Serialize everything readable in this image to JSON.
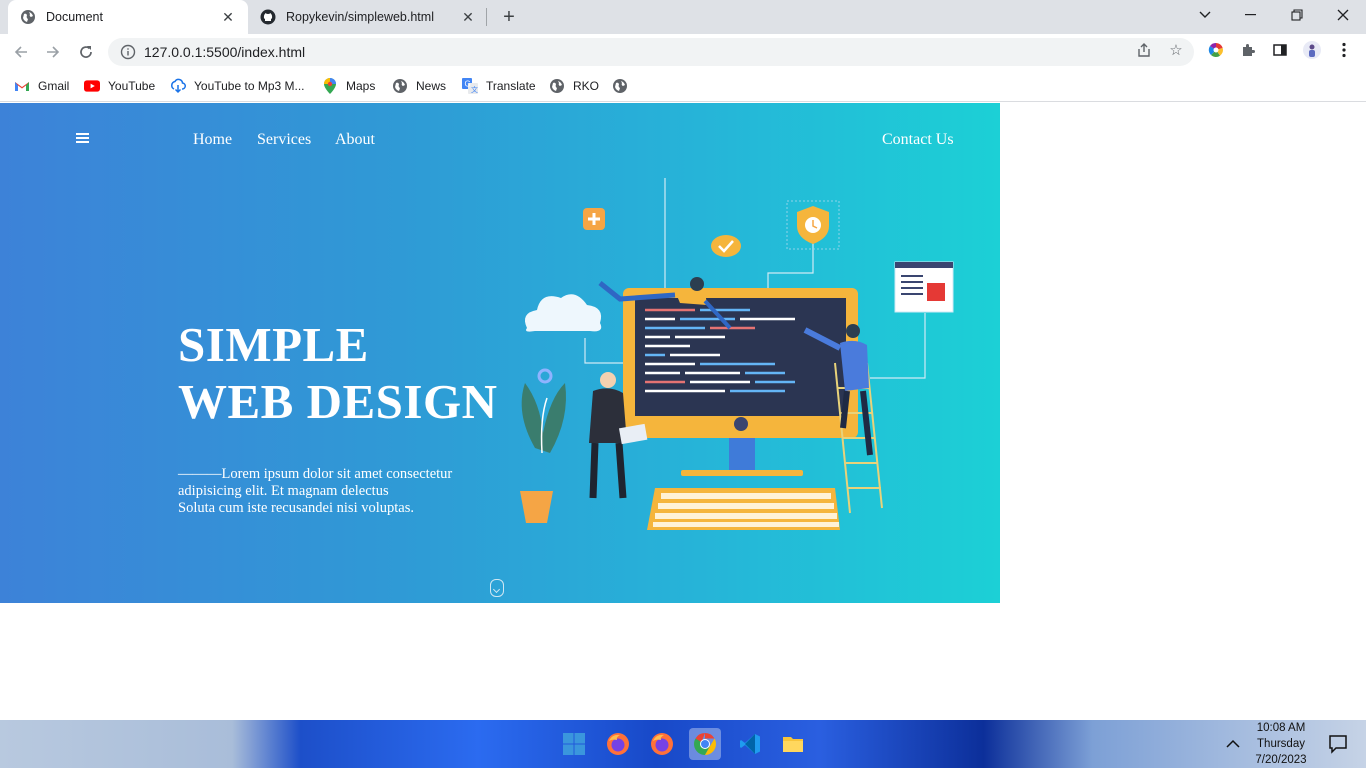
{
  "browser": {
    "tabs": [
      {
        "title": "Document",
        "active": true,
        "icon": "globe-icon"
      },
      {
        "title": "Ropykevin/simpleweb.html",
        "active": false,
        "icon": "github-icon"
      }
    ],
    "address": "127.0.0.1:5500/index.html",
    "bookmarks": [
      {
        "label": "Gmail",
        "icon": "gmail-icon"
      },
      {
        "label": "YouTube",
        "icon": "youtube-icon"
      },
      {
        "label": "YouTube to Mp3 M...",
        "icon": "download-icon"
      },
      {
        "label": "Maps",
        "icon": "maps-icon"
      },
      {
        "label": "News",
        "icon": "globe-icon"
      },
      {
        "label": "Translate",
        "icon": "translate-icon"
      },
      {
        "label": "RKO",
        "icon": "globe-icon"
      }
    ]
  },
  "page": {
    "nav": {
      "home": "Home",
      "services": "Services",
      "about": "About",
      "contact": "Contact Us"
    },
    "hero": {
      "title_line1": "SIMPLE",
      "title_line2": "WEB DESIGN",
      "desc_line1": "———Lorem ipsum dolor sit amet consectetur",
      "desc_line2": "adipisicing elit. Et magnam delectus",
      "desc_line3": "Soluta cum iste recusandei nisi voluptas."
    }
  },
  "taskbar": {
    "time": "10:08 AM",
    "day": "Thursday",
    "date": "7/20/2023"
  },
  "colors": {
    "hero_start": "#3d82d8",
    "hero_end": "#1cd0d6",
    "tabstrip": "#dee1e6"
  }
}
